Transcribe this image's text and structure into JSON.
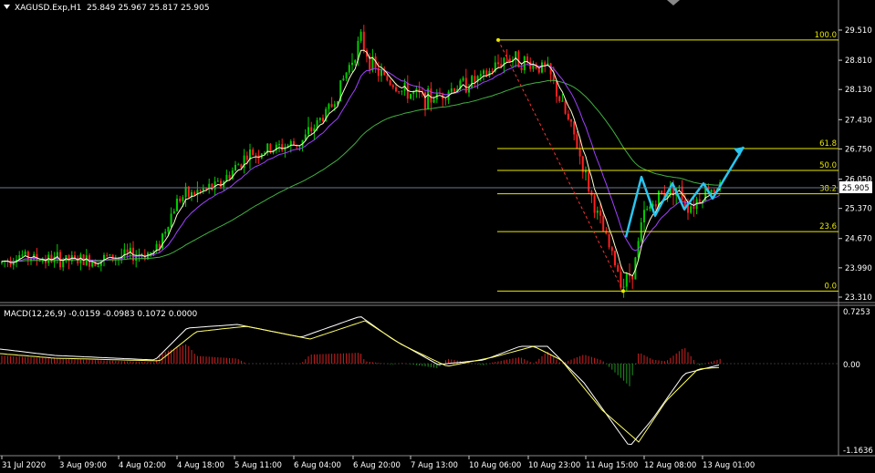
{
  "header": {
    "symbol": "XAGUSD.Exp,H1",
    "ohlc": "25.849 25.967 25.817 25.905"
  },
  "price_axis": {
    "ticks": [
      "29.510",
      "28.810",
      "28.130",
      "27.430",
      "26.750",
      "26.050",
      "25.370",
      "24.670",
      "23.990",
      "23.310"
    ],
    "current_price": "25.905"
  },
  "fibonacci": {
    "levels": [
      {
        "label": "100.0",
        "price": 29.28
      },
      {
        "label": "61.8",
        "price": 26.76
      },
      {
        "label": "50.0",
        "price": 26.25
      },
      {
        "label": "38.2",
        "price": 25.71
      },
      {
        "label": "23.6",
        "price": 24.83
      },
      {
        "label": "0.0",
        "price": 23.45
      }
    ]
  },
  "macd": {
    "title": "MACD(12,26,9) -0.0159 -0.0983 0.1072 0.0000",
    "ticks": [
      "0.7253",
      "0.00",
      "-1.1636"
    ]
  },
  "time_axis": {
    "labels": [
      "31 Jul 2020",
      "3 Aug 09:00",
      "4 Aug 02:00",
      "4 Aug 18:00",
      "5 Aug 11:00",
      "6 Aug 04:00",
      "6 Aug 20:00",
      "7 Aug 13:00",
      "10 Aug 06:00",
      "10 Aug 23:00",
      "11 Aug 15:00",
      "12 Aug 08:00",
      "13 Aug 01:00"
    ]
  },
  "colors": {
    "background": "#000000",
    "bull": "#00cc00",
    "bear": "#ff2020",
    "fib": "#e8e800",
    "ma_fast": "#ffffcc",
    "ma_mid": "#a040ff",
    "ma_slow": "#40b040",
    "forecast": "#29c6f0",
    "grid": "#555555"
  },
  "icons": [
    "menu-triangle-icon",
    "scroll-marker-icon"
  ]
}
